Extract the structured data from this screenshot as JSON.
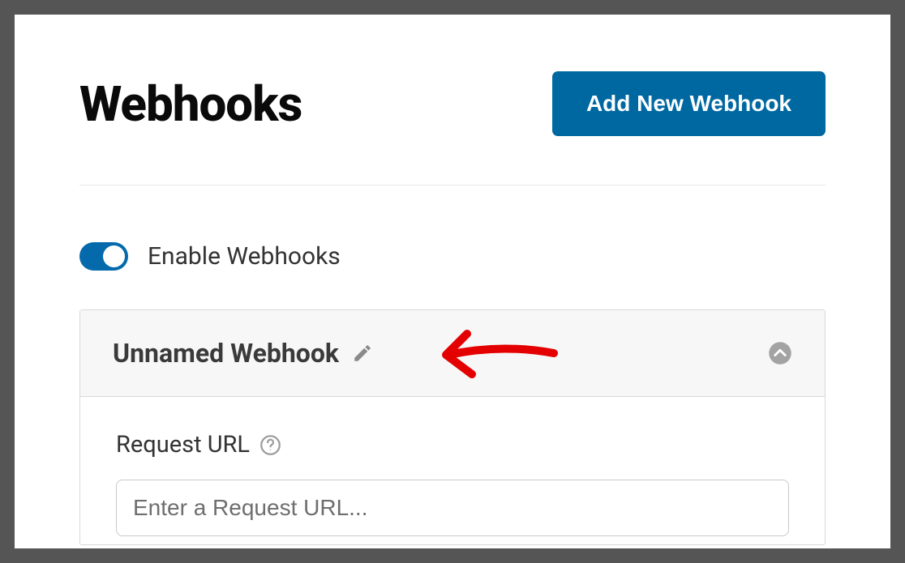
{
  "header": {
    "title": "Webhooks",
    "add_button": "Add New Webhook"
  },
  "toggle": {
    "label": "Enable Webhooks",
    "enabled": true
  },
  "panel": {
    "title": "Unnamed Webhook",
    "request_url": {
      "label": "Request URL",
      "placeholder": "Enter a Request URL...",
      "value": ""
    }
  }
}
